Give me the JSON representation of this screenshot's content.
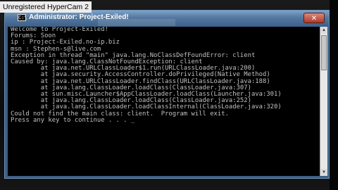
{
  "overlay": {
    "watermark": "Unregistered HyperCam 2"
  },
  "window": {
    "title": "Administrator: Project-Exiled!",
    "icon": "console-icon",
    "close_icon": "close-icon"
  },
  "console": {
    "lines": [
      "Welcome to Project-Exiled!",
      "Forums: Soon",
      "ip : Project-Exiled.no-ip.biz",
      "msn : Stephen-s@live.com",
      "Exception in thread \"main\" java.lang.NoClassDefFoundError: client",
      "Caused by: java.lang.ClassNotFoundException: client",
      "        at java.net.URLClassLoader$1.run(URLClassLoader.java:200)",
      "        at java.security.AccessController.doPrivileged(Native Method)",
      "        at java.net.URLClassLoader.findClass(URLClassLoader.java:188)",
      "        at java.lang.ClassLoader.loadClass(ClassLoader.java:307)",
      "        at sun.misc.Launcher$AppClassLoader.loadClass(Launcher.java:301)",
      "        at java.lang.ClassLoader.loadClass(ClassLoader.java:252)",
      "        at java.lang.ClassLoader.loadClassInternal(ClassLoader.java:320)",
      "Could not find the main class: client.  Program will exit.",
      "Press any key to continue . . . _"
    ]
  }
}
